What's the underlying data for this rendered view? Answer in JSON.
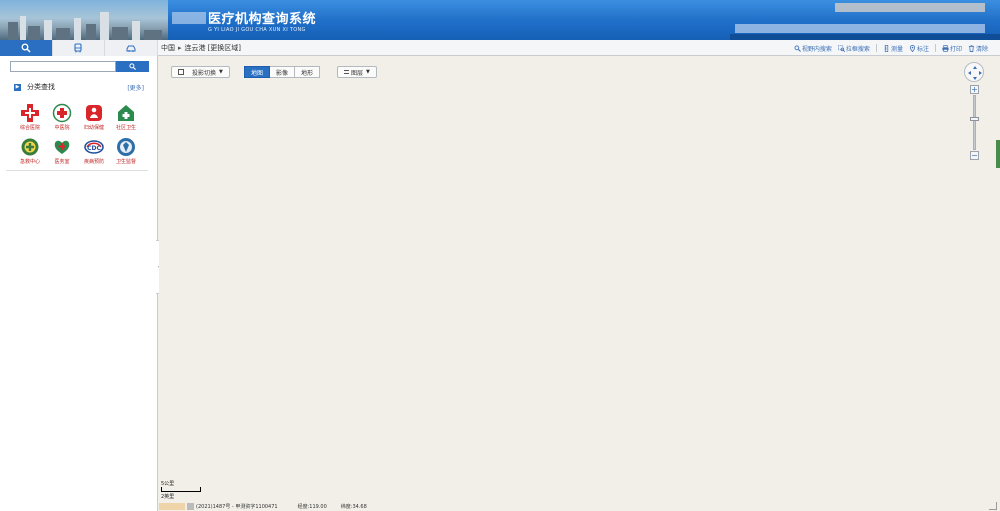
{
  "header": {
    "title": "医疗机构查询系统",
    "subtitle": "G YI LIAO JI GOU CHA XUN XI TONG"
  },
  "tabs": [
    {
      "name": "tab-search",
      "icon": "search-icon"
    },
    {
      "name": "tab-bus",
      "icon": "bus-icon"
    },
    {
      "name": "tab-drive",
      "icon": "car-icon"
    }
  ],
  "breadcrumb": {
    "country": "中国",
    "separator": "▸",
    "city": "连云港",
    "change": "[更换区域]"
  },
  "tools": {
    "view_search": "视野内搜索",
    "box_search": "拉框搜索",
    "measure": "测量",
    "mark": "标注",
    "print": "打印",
    "clear": "清除"
  },
  "search": {
    "placeholder": "",
    "value": ""
  },
  "category": {
    "title": "分类查找",
    "more": "[更多]",
    "items": [
      {
        "label": "综合医院",
        "icon": "hospital-cross-icon",
        "color": "#d9262a"
      },
      {
        "label": "中医院",
        "icon": "tcm-hospital-icon",
        "color": "#c43a2f"
      },
      {
        "label": "妇幼保健",
        "icon": "maternal-child-icon",
        "color": "#d9262a"
      },
      {
        "label": "社区卫生",
        "icon": "community-health-icon",
        "color": "#2d8a4e"
      },
      {
        "label": "急救中心",
        "icon": "emergency-center-icon",
        "color": "#3a7c3a"
      },
      {
        "label": "医务室",
        "icon": "clinic-icon",
        "color": "#d9262a"
      },
      {
        "label": "疾病预防",
        "icon": "cdc-icon",
        "color": "#2350a0"
      },
      {
        "label": "卫生监督",
        "icon": "health-supervision-icon",
        "color": "#2f6fa8"
      }
    ]
  },
  "map_controls": {
    "projection": "投影切换",
    "types": [
      "地图",
      "影像",
      "地形"
    ],
    "active_type": "地图",
    "layers": "图层"
  },
  "scale": {
    "upper": "5公里",
    "lower": "2英里"
  },
  "footer": {
    "license": "(2021)1487号 - 甲测资字1100471",
    "longitude_label": "经度:",
    "longitude": "119.00",
    "latitude_label": "纬度:",
    "latitude": "34.68"
  },
  "colors": {
    "header_blue": "#1f6ec7",
    "accent_blue": "#2a6fc2",
    "map_bg": "#f1efe8"
  }
}
